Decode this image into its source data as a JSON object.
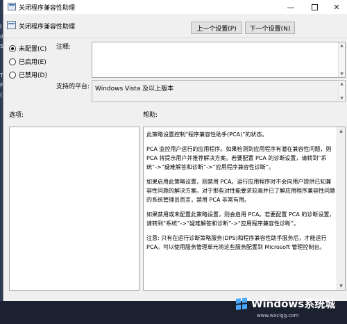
{
  "window": {
    "title": "关闭程序兼容性助理",
    "minimize_glyph": "—",
    "close_glyph": "✕"
  },
  "header": {
    "setting_name": "关闭程序兼容性助理",
    "prev_button": "上一个设置(P)",
    "next_button": "下一个设置(N)"
  },
  "state": {
    "options": [
      {
        "label": "未配置(C)",
        "selected": true
      },
      {
        "label": "已启用(E)",
        "selected": false
      },
      {
        "label": "已禁用(D)",
        "selected": false
      }
    ]
  },
  "comment": {
    "label": "注释:"
  },
  "platform": {
    "label": "支持的平台:",
    "value": "Windows Vista 及以上版本"
  },
  "options_panel": {
    "label": "选项:"
  },
  "help_panel": {
    "label": "帮助:",
    "paragraphs": [
      "此策略设置控制“程序兼容性助手(PCA)”的状态。",
      "PCA 监控用户运行的应用程序。如果检测到应用程序有潜在兼容性问题，则 PCA 将提示用户并推荐解决方案。若要配置 PCA 的诊断设置，请转到“系统”->“疑难解答和诊断”->“应用程序兼容性诊断”。",
      "如果启用此策略设置，则禁用 PCA。运行应用程序时不会向用户提供已知兼容性问题的解决方案。对于那些对性能要求较高并已了解应用程序兼容性问题的系统管理员而言，禁用 PCA 非常有用。",
      "如果禁用或未配置此策略设置，则会启用 PCA。若要配置 PCA 的诊断设置，请转到“系统”->“疑难解答和诊断”->“应用程序兼容性诊断”。",
      "注意: 只有在运行诊断策略服务(DPS)和程序兼容性助手服务后，才能运行 PCA。可以使用服务管理单元将这些服务配置到 Microsoft 管理控制台。"
    ]
  },
  "desktop": {
    "fragments": [
      "I",
      "d",
      "S",
      "",
      "T",
      "F",
      "("
    ]
  },
  "watermark": {
    "brand": "Windows系统城",
    "url": "www.wxclgg.com",
    "color": "#4aa8ff"
  }
}
